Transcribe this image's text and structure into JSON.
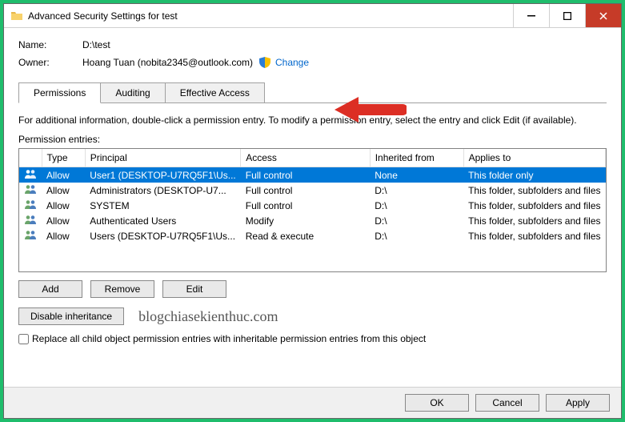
{
  "window": {
    "title": "Advanced Security Settings for test"
  },
  "info": {
    "name_label": "Name:",
    "name_value": "D:\\test",
    "owner_label": "Owner:",
    "owner_value": "Hoang Tuan (nobita2345@outlook.com)",
    "change_link": "Change"
  },
  "tabs": {
    "permissions": "Permissions",
    "auditing": "Auditing",
    "effective_access": "Effective Access",
    "active": 0
  },
  "tab_info": "For additional information, double-click a permission entry. To modify a permission entry, select the entry and click Edit (if available).",
  "entries_label": "Permission entries:",
  "columns": {
    "type": "Type",
    "principal": "Principal",
    "access": "Access",
    "inherited": "Inherited from",
    "applies": "Applies to"
  },
  "entries": [
    {
      "type": "Allow",
      "principal": "User1 (DESKTOP-U7RQ5F1\\Us...",
      "access": "Full control",
      "inherited": "None",
      "applies": "This folder only",
      "selected": true
    },
    {
      "type": "Allow",
      "principal": "Administrators (DESKTOP-U7...",
      "access": "Full control",
      "inherited": "D:\\",
      "applies": "This folder, subfolders and files",
      "selected": false
    },
    {
      "type": "Allow",
      "principal": "SYSTEM",
      "access": "Full control",
      "inherited": "D:\\",
      "applies": "This folder, subfolders and files",
      "selected": false
    },
    {
      "type": "Allow",
      "principal": "Authenticated Users",
      "access": "Modify",
      "inherited": "D:\\",
      "applies": "This folder, subfolders and files",
      "selected": false
    },
    {
      "type": "Allow",
      "principal": "Users (DESKTOP-U7RQ5F1\\Us...",
      "access": "Read & execute",
      "inherited": "D:\\",
      "applies": "This folder, subfolders and files",
      "selected": false
    }
  ],
  "buttons": {
    "add": "Add",
    "remove": "Remove",
    "edit": "Edit",
    "disable_inheritance": "Disable inheritance",
    "ok": "OK",
    "cancel": "Cancel",
    "apply": "Apply"
  },
  "checkbox": {
    "replace_label": "Replace all child object permission entries with inheritable permission entries from this object"
  },
  "watermark": "blogchiasekienthuc.com"
}
